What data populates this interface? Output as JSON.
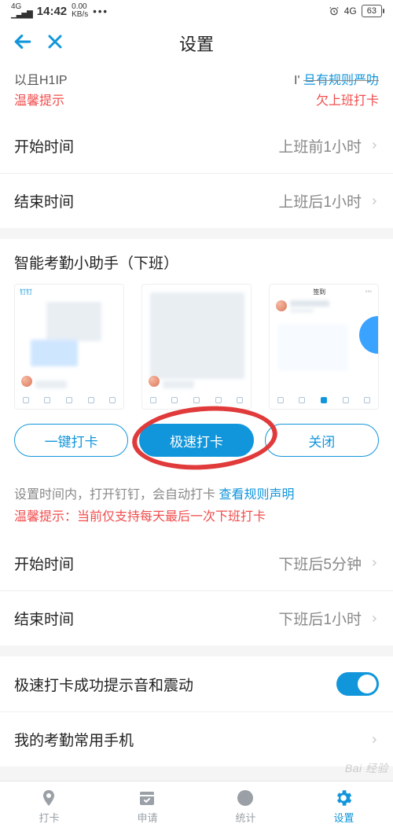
{
  "status_bar": {
    "signal_label": "4G",
    "time": "14:42",
    "kbs_top": "0.00",
    "kbs_bottom": "KB/s",
    "dots": "•••",
    "net_label": "4G",
    "battery_pct": "63"
  },
  "nav": {
    "title": "设置"
  },
  "section1": {
    "partial_left": "以且H1IP",
    "partial_right_prefix": "I'",
    "rule_link": "旦有规则严叻",
    "warm_prefix": "温馨提示",
    "warm_suffix": "欠上班打卡",
    "rows": [
      {
        "label": "开始时间",
        "value": "上班前1小时"
      },
      {
        "label": "结束时间",
        "value": "上班后1小时"
      }
    ]
  },
  "assistant": {
    "title": "智能考勤小助手（下班）",
    "mode_options": [
      "一键打卡",
      "极速打卡",
      "关闭"
    ],
    "desc_text": "设置时间内，打开钉钉，会自动打卡 ",
    "desc_link": "查看规则声明",
    "warm_line": "温馨提示：当前仅支持每天最后一次下班打卡",
    "rows": [
      {
        "label": "开始时间",
        "value": "下班后5分钟"
      },
      {
        "label": "结束时间",
        "value": "下班后1小时"
      }
    ]
  },
  "settings": {
    "sound_vibrate": "极速打卡成功提示音和震动",
    "my_phone": "我的考勤常用手机"
  },
  "tabs": {
    "items": [
      "打卡",
      "申请",
      "统计",
      "设置"
    ]
  },
  "watermark": "Bai 经验"
}
